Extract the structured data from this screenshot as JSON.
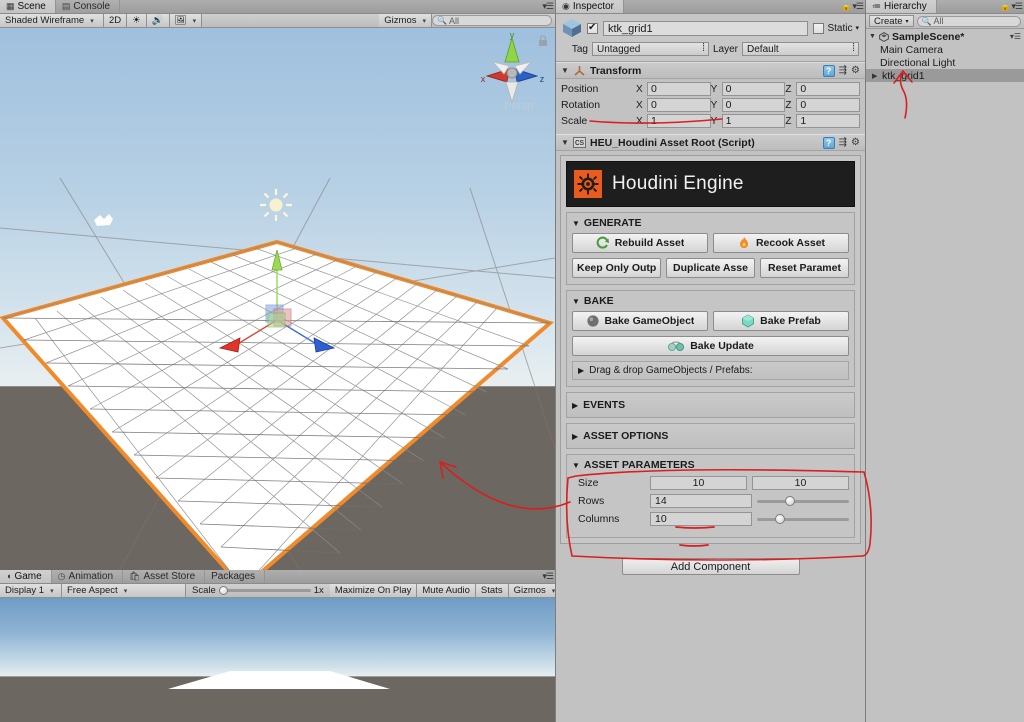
{
  "scene_panel": {
    "tabs": [
      {
        "label": "Scene",
        "icon": "grid-icon",
        "active": true
      },
      {
        "label": "Console",
        "icon": "console-icon",
        "active": false
      }
    ],
    "toolbar": {
      "draw_mode": "Shaded Wireframe",
      "two_d": "2D",
      "lighting_icon": "sun-icon",
      "audio_icon": "speaker-icon",
      "fx_icon": "image-icon",
      "gizmos": "Gizmos",
      "search_placeholder": "All",
      "search_icon": "search-icon"
    },
    "viewport": {
      "axis_gizmo": {
        "y_label": "y",
        "x_label": "x",
        "z_label": "z",
        "lock_icon": "lock-icon"
      },
      "perspective_label": "Persp",
      "camera_icon": "camera-gizmo-icon",
      "light_icon": "directional-light-gizmo-icon",
      "selected_object_outline_color": "#f08a2a",
      "ground_color": "#6d6761",
      "mesh_color": "#ffffff"
    }
  },
  "game_panel": {
    "tabs": [
      {
        "label": "Game",
        "icon": "game-icon",
        "active": true
      },
      {
        "label": "Animation",
        "icon": "clock-icon",
        "active": false
      },
      {
        "label": "Asset Store",
        "icon": "store-icon",
        "active": false
      },
      {
        "label": "Packages",
        "icon": "",
        "active": false
      }
    ],
    "toolbar": {
      "display": "Display 1",
      "aspect": "Free Aspect",
      "scale_label": "Scale",
      "scale_value": "1x",
      "maximize_on_play": "Maximize On Play",
      "mute_audio": "Mute Audio",
      "stats": "Stats",
      "gizmos": "Gizmos"
    }
  },
  "inspector": {
    "tab_label": "Inspector",
    "tab_icon": "inspector-icon",
    "lock_icon": "lock-icon",
    "menu_icon": "panel-menu-icon",
    "object": {
      "enabled": true,
      "name": "ktk_grid1",
      "static_label": "Static",
      "static_checked": false,
      "tag_label": "Tag",
      "tag_value": "Untagged",
      "layer_label": "Layer",
      "layer_value": "Default"
    },
    "transform": {
      "title": "Transform",
      "icon": "transform-icon",
      "rows": [
        {
          "label": "Position",
          "x": "0",
          "y": "0",
          "z": "0"
        },
        {
          "label": "Rotation",
          "x": "0",
          "y": "0",
          "z": "0"
        },
        {
          "label": "Scale",
          "x": "1",
          "y": "1",
          "z": "1"
        }
      ],
      "axis_labels": {
        "x": "X",
        "y": "Y",
        "z": "Z"
      }
    },
    "houdini": {
      "component_title": "HEU_Houdini Asset Root (Script)",
      "component_icon": "script-icon",
      "banner_text": "Houdini Engine",
      "banner_bg": "#1e1e1e",
      "logo_bg": "#eb5b1e",
      "generate": {
        "title": "GENERATE",
        "buttons": [
          {
            "label": "Rebuild Asset",
            "icon": "refresh-icon"
          },
          {
            "label": "Recook Asset",
            "icon": "flame-icon"
          },
          {
            "label": "Keep Only Outp",
            "icon": ""
          },
          {
            "label": "Duplicate Asse",
            "icon": ""
          },
          {
            "label": "Reset Paramet",
            "icon": ""
          }
        ]
      },
      "bake": {
        "title": "BAKE",
        "buttons": [
          {
            "label": "Bake GameObject",
            "icon": "sphere-icon"
          },
          {
            "label": "Bake Prefab",
            "icon": "prefab-icon"
          },
          {
            "label": "Bake Update",
            "icon": "bake-update-icon"
          }
        ],
        "dragdrop_label": "Drag & drop GameObjects / Prefabs:"
      },
      "events": {
        "title": "EVENTS"
      },
      "asset_options": {
        "title": "ASSET OPTIONS"
      },
      "asset_parameters": {
        "title": "ASSET PARAMETERS",
        "params": [
          {
            "label": "Size",
            "type": "vector2",
            "value_x": "10",
            "value_y": "10"
          },
          {
            "label": "Rows",
            "type": "slider",
            "value": "14",
            "slider_pct": 30
          },
          {
            "label": "Columns",
            "type": "slider",
            "value": "10",
            "slider_pct": 20
          }
        ]
      }
    },
    "add_component_label": "Add Component"
  },
  "hierarchy": {
    "tab_label": "Hierarchy",
    "tab_icon": "hierarchy-icon",
    "lock_icon": "lock-icon",
    "menu_icon": "panel-menu-icon",
    "create_label": "Create",
    "search_placeholder": "All",
    "search_icon": "search-icon",
    "items": [
      {
        "label": "SampleScene*",
        "depth": 0,
        "expanded": true,
        "selected": false,
        "icon": "unity-scene-icon"
      },
      {
        "label": "Main Camera",
        "depth": 1,
        "expanded": false,
        "selected": false,
        "icon": ""
      },
      {
        "label": "Directional Light",
        "depth": 1,
        "expanded": false,
        "selected": false,
        "icon": ""
      },
      {
        "label": "ktk_grid1",
        "depth": 1,
        "expanded": false,
        "selected": true,
        "icon": ""
      }
    ]
  },
  "annotations": {
    "color": "#d91f1f",
    "marks": [
      "underline-component-title",
      "arrow-to-hierarchy-ktk-grid1",
      "arrow-to-scene-mesh",
      "box-around-asset-parameters",
      "underline-rows-value",
      "underline-columns-value"
    ]
  }
}
